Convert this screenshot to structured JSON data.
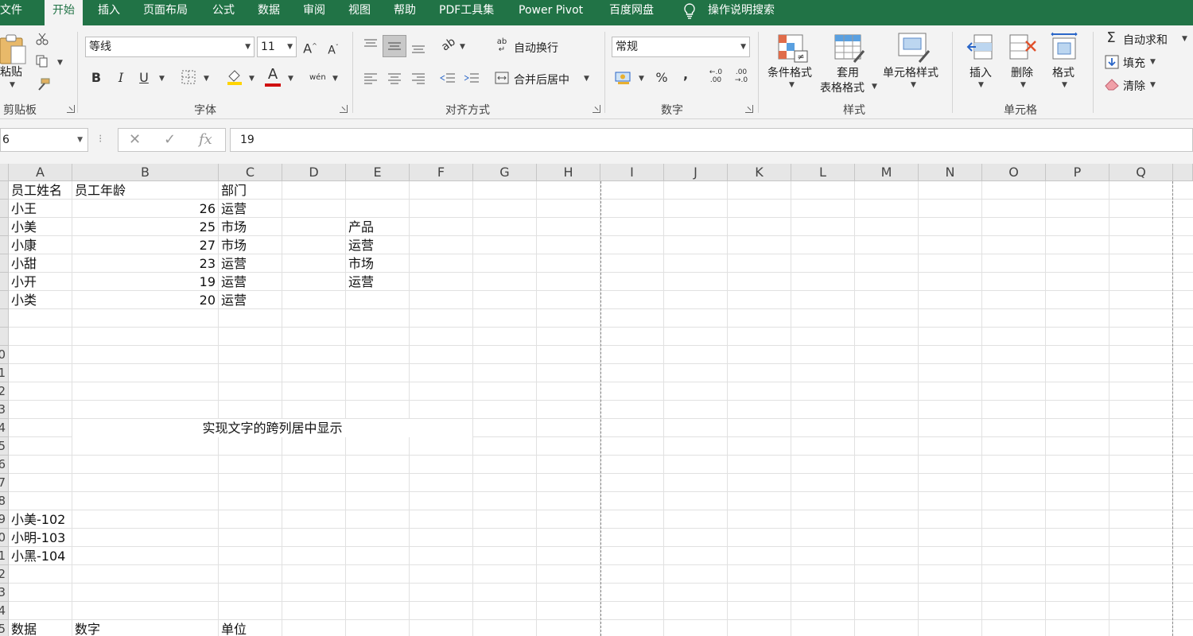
{
  "menu": {
    "tabs": [
      "文件",
      "开始",
      "插入",
      "页面布局",
      "公式",
      "数据",
      "审阅",
      "视图",
      "帮助",
      "PDF工具集",
      "Power Pivot",
      "百度网盘"
    ],
    "active_tab": "开始",
    "tell_me": "操作说明搜索"
  },
  "ribbon": {
    "clipboard": {
      "paste": "粘贴",
      "label": "剪贴板"
    },
    "font": {
      "name": "等线",
      "size": "11",
      "bold": "B",
      "italic": "I",
      "underline": "U",
      "grow": "A",
      "shrink": "A",
      "phonetic": "wén",
      "font_color_letter": "A",
      "label": "字体"
    },
    "alignment": {
      "wrap": "自动换行",
      "merge": "合并后居中",
      "label": "对齐方式"
    },
    "number": {
      "format": "常规",
      "percent": "%",
      "comma": ",",
      "increase_decimal": "←.0\n.00",
      "decrease_decimal": ".00\n→.0",
      "label": "数字"
    },
    "styles": {
      "conditional": "条件格式",
      "table_format_1": "套用",
      "table_format_2": "表格格式",
      "cell_styles": "单元格样式",
      "label": "样式"
    },
    "cells": {
      "insert": "插入",
      "delete": "删除",
      "format": "格式",
      "label": "单元格"
    },
    "editing": {
      "autosum": "自动求和",
      "fill": "填充",
      "clear": "清除"
    }
  },
  "formula_bar": {
    "name_box": "6",
    "formula": "19",
    "cancel": "✕",
    "enter": "✓",
    "fx": "fx"
  },
  "sheet": {
    "columns": [
      "A",
      "B",
      "C",
      "D",
      "E",
      "F",
      "G",
      "H",
      "I",
      "J",
      "K",
      "L",
      "M",
      "N",
      "O",
      "P",
      "Q"
    ],
    "row_numbers": [
      "",
      "",
      "",
      "",
      "",
      "",
      "",
      "",
      "",
      "0",
      "1",
      "2",
      "3",
      "4",
      "5",
      "6",
      "7",
      "8",
      "9",
      "0",
      "1",
      "2",
      "3",
      "4",
      "5"
    ],
    "cells": {
      "A1": "员工姓名",
      "B1": "员工年龄",
      "C1": "部门",
      "A2": "小王",
      "B2": "26",
      "C2": "运营",
      "A3": "小美",
      "B3": "25",
      "C3": "市场",
      "E3": "产品",
      "A4": "小康",
      "B4": "27",
      "C4": "市场",
      "E4": "运营",
      "A5": "小甜",
      "B5": "23",
      "C5": "运营",
      "E5": "市场",
      "A6": "小开",
      "B6": "19",
      "C6": "运营",
      "E6": "运营",
      "A7": "小类",
      "B7": "20",
      "C7": "运营",
      "merged_text": "实现文字的跨列居中显示",
      "A19": "小美-102",
      "A20": "小明-103",
      "A21": "小黑-104",
      "A25": "数据",
      "B25": "数字",
      "C25": "单位"
    }
  }
}
